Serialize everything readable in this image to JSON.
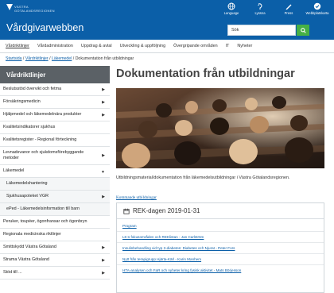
{
  "header": {
    "logo_text": "VÄSTRA GÖTALANDSREGIONEN",
    "site_title": "Vårdgivarwebben",
    "tools": [
      {
        "label": "Language",
        "icon": "globe-icon"
      },
      {
        "label": "Lyssna",
        "icon": "listen-icon"
      },
      {
        "label": "Press",
        "icon": "pen-icon"
      },
      {
        "label": "Webbplatskarta",
        "icon": "sitemap-icon"
      }
    ],
    "search_value": "Sök",
    "search_button_icon": "search-icon"
  },
  "topnav": [
    "Vårdriktlinjer",
    "Vårdadministration",
    "Uppdrag & avtal",
    "Utveckling & uppföljning",
    "Övergripande områden",
    "IT",
    "Nyheter"
  ],
  "breadcrumb": {
    "links": [
      "Startsida",
      "Vårdriktlinjer",
      "Läkemedel"
    ],
    "separator": " / ",
    "current": "Dokumentation från utbildningar"
  },
  "sidebar": {
    "title": "Vårdriktlinjer",
    "items": [
      {
        "label": "Beslutsstöd övervikt och fetma",
        "arrow": "right",
        "sub": false
      },
      {
        "label": "Försäkringsmedicin",
        "arrow": "right",
        "sub": false
      },
      {
        "label": "Hjälpmedel och läkemedelnära produkter",
        "arrow": "right",
        "sub": false
      },
      {
        "label": "Kvalitetsindikatorer sjukhus",
        "arrow": "",
        "sub": false
      },
      {
        "label": "Kvalitetsregister - Regional förteckning",
        "arrow": "",
        "sub": false
      },
      {
        "label": "Levnadsvanor och sjukdomsförebyggande metoder",
        "arrow": "right",
        "sub": false
      },
      {
        "label": "Läkemedel",
        "arrow": "down",
        "sub": false
      },
      {
        "label": "Läkemedelshantering",
        "arrow": "",
        "sub": true
      },
      {
        "label": "Sjukhusapoteket VGR",
        "arrow": "right",
        "sub": true
      },
      {
        "label": "ePed - Läkemedelsinformation till barn",
        "arrow": "",
        "sub": true
      },
      {
        "label": "Peruker, toupéer, ögonfransar och ögonbryn",
        "arrow": "",
        "sub": false
      },
      {
        "label": "Regionala medicinska riktlinjer",
        "arrow": "",
        "sub": false
      },
      {
        "label": "Smittskydd Västra Götaland",
        "arrow": "right",
        "sub": false
      },
      {
        "label": "Strama Västra Götaland",
        "arrow": "right",
        "sub": false
      },
      {
        "label": "Stöd till ...",
        "arrow": "right",
        "sub": false
      }
    ]
  },
  "main": {
    "title": "Dokumentation från utbildningar",
    "intro": "Utbildningsmaterial/dokumentation från läkemedelsutbildningar i Västra Götalandsregionen.",
    "more_link": "Kommande utbildningar",
    "card": {
      "icon": "calendar-icon",
      "title": "REK-dagen 2019-01-31",
      "links": [
        "Program",
        "LK:s fokusområden och REKlistan - Jan Carlström",
        "Insulinbehandling vid typ 2-diabetes: Diabetes och Njurat - Peter Fors",
        "Nytt från terapigrupp Hjärta-Kärl - Karin Manhem",
        "HTA-analysen och FaR och nyheter kring fysisk aktivitet - Mats Börjesson"
      ]
    }
  },
  "colors": {
    "header_bg": "#0b5fa8",
    "sidebar_head_bg": "#5b6166",
    "search_button": "#46b045",
    "link": "#0b5fa8"
  }
}
